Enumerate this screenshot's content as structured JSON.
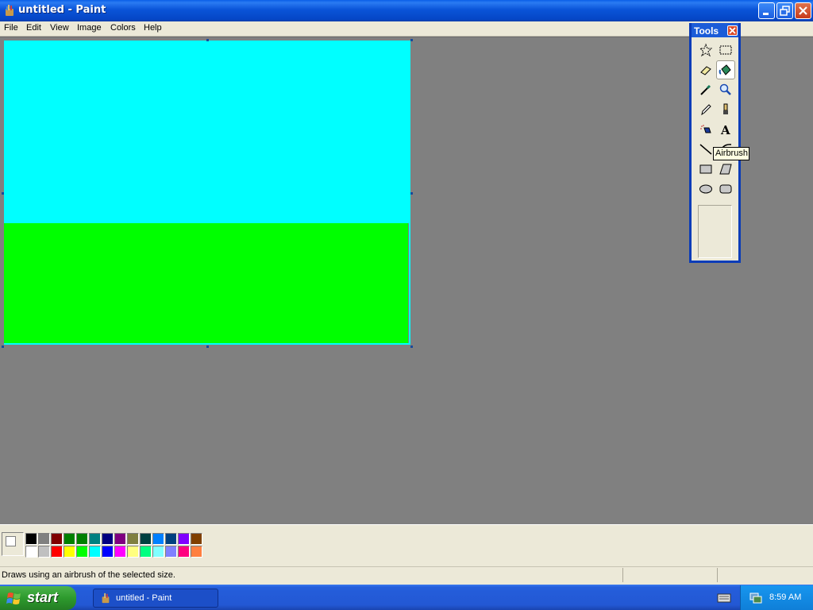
{
  "window": {
    "title": "untitled - Paint"
  },
  "menu": {
    "items": [
      "File",
      "Edit",
      "View",
      "Image",
      "Colors",
      "Help"
    ]
  },
  "tools": {
    "title": "Tools",
    "icons": [
      "free-form-select-icon",
      "select-icon",
      "eraser-icon",
      "fill-with-color-icon",
      "pick-color-icon",
      "magnifier-icon",
      "pencil-icon",
      "brush-icon",
      "airbrush-icon",
      "text-icon",
      "line-icon",
      "curve-icon",
      "rectangle-icon",
      "polygon-icon",
      "ellipse-icon",
      "rounded-rectangle-icon"
    ],
    "active": "fill-with-color-icon",
    "tooltip": "Airbrush"
  },
  "canvas": {
    "sky_color": "#00ffff",
    "grass_color": "#00ff00"
  },
  "palette": {
    "foreground": "#ffffff",
    "background": "#ffffff",
    "row1": [
      "#000000",
      "#808080",
      "#800000",
      "#008000",
      "#008000",
      "#008080",
      "#000080",
      "#800080",
      "#808040",
      "#004040",
      "#0080ff",
      "#004080",
      "#8000ff",
      "#804000"
    ],
    "row2": [
      "#ffffff",
      "#c0c0c0",
      "#ff0000",
      "#ffff00",
      "#00ff00",
      "#00ffff",
      "#0000ff",
      "#ff00ff",
      "#ffff80",
      "#00ff80",
      "#80ffff",
      "#8080ff",
      "#ff0080",
      "#ff8040"
    ]
  },
  "status": {
    "text": "Draws using an airbrush of the selected size."
  },
  "taskbar": {
    "start_label": "start",
    "task_label": "untitled - Paint",
    "clock": "8:59 AM"
  }
}
